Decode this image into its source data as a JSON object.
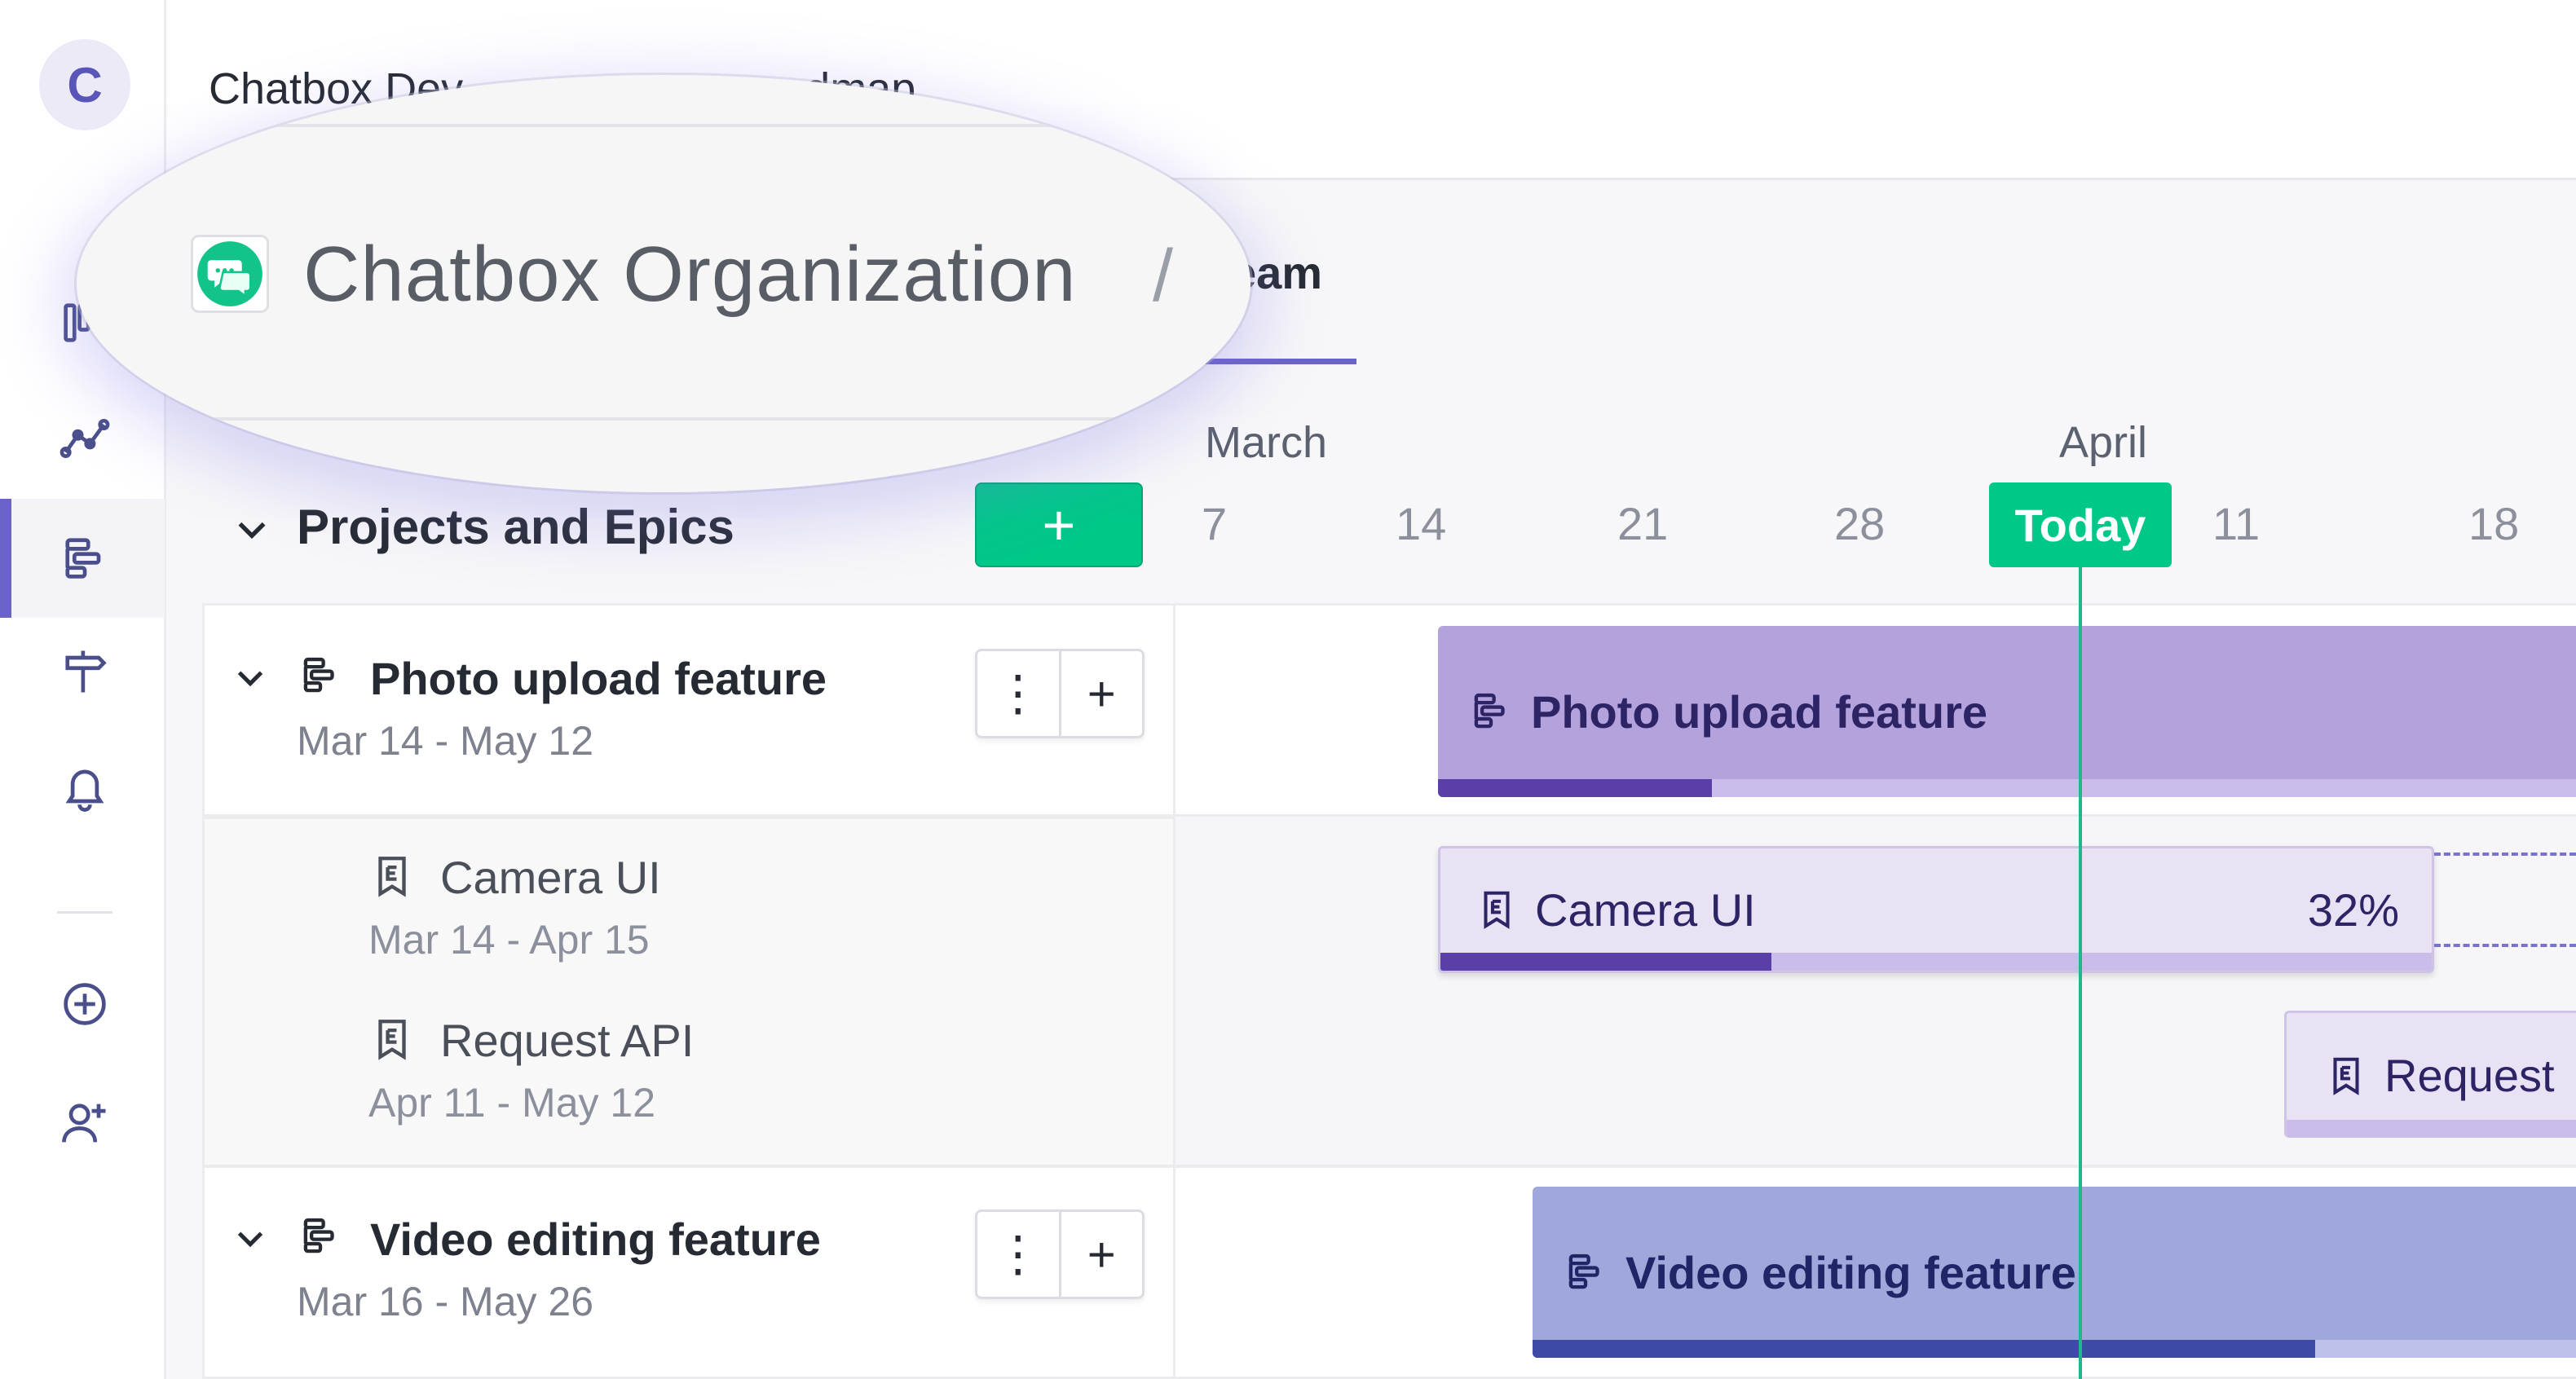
{
  "sidebar": {
    "avatar_letter": "C",
    "items": [
      {
        "icon": "board-icon"
      },
      {
        "icon": "chart-line-icon"
      },
      {
        "icon": "roadmap-icon",
        "active": true
      },
      {
        "icon": "signpost-icon"
      },
      {
        "icon": "bell-icon"
      },
      {
        "icon": "add-circle-icon"
      },
      {
        "icon": "add-user-icon"
      }
    ],
    "accent_color": "#6b63c7"
  },
  "header": {
    "title": "Chatbox Dev",
    "title_tail": "dmap",
    "active_tab_label": "eam"
  },
  "magnifier": {
    "org_name": "Chatbox Organization",
    "separator": "/"
  },
  "timeline": {
    "months": [
      "March",
      "April"
    ],
    "days": [
      "7",
      "14",
      "21",
      "28",
      "11",
      "18"
    ],
    "today_label": "Today",
    "today_color": "#00c889"
  },
  "section": {
    "title": "Projects and Epics",
    "add_label": "+"
  },
  "projects": [
    {
      "name": "Photo upload feature",
      "dates": "Mar 14 - May 12",
      "bar_label": "Photo upload feature",
      "bar_color": "#b3a2dc",
      "menu_label": "⋮",
      "add_label": "+",
      "epics": [
        {
          "name": "Camera UI",
          "dates": "Mar 14 - Apr 15",
          "bar_label": "Camera UI",
          "progress_text": "32%",
          "progress": 0.32
        },
        {
          "name": "Request API",
          "dates": "Apr 11 - May 12",
          "bar_label": "Request"
        }
      ]
    },
    {
      "name": "Video editing feature",
      "dates": "Mar 16 - May 26",
      "bar_label": "Video editing feature",
      "bar_color": "#a0a8db",
      "menu_label": "⋮",
      "add_label": "+"
    }
  ]
}
